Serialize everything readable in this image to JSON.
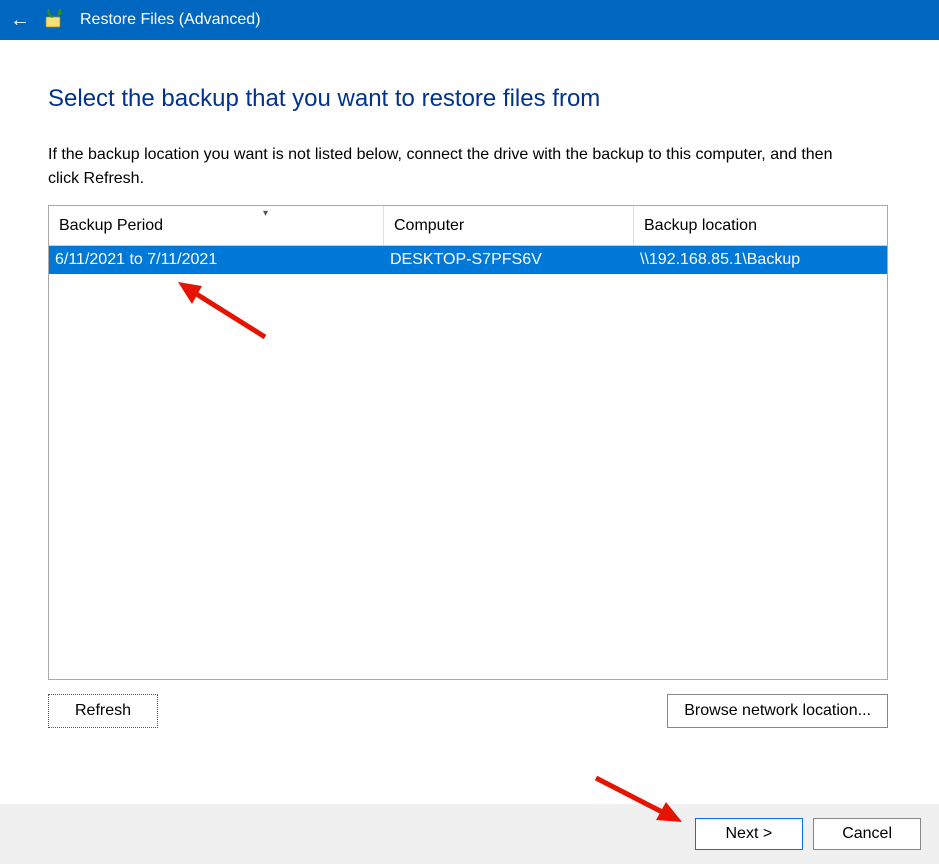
{
  "titlebar": {
    "title": "Restore Files (Advanced)"
  },
  "heading": "Select the backup that you want to restore files from",
  "instructions": "If the backup location you want is not listed below, connect the drive with the backup to this computer, and then click Refresh.",
  "table": {
    "headers": {
      "period": "Backup Period",
      "computer": "Computer",
      "location": "Backup location"
    },
    "rows": [
      {
        "period": "6/11/2021 to 7/11/2021",
        "computer": "DESKTOP-S7PFS6V",
        "location": "\\\\192.168.85.1\\Backup"
      }
    ]
  },
  "buttons": {
    "refresh": "Refresh",
    "browse": "Browse network location...",
    "next": "Next >",
    "cancel": "Cancel"
  }
}
